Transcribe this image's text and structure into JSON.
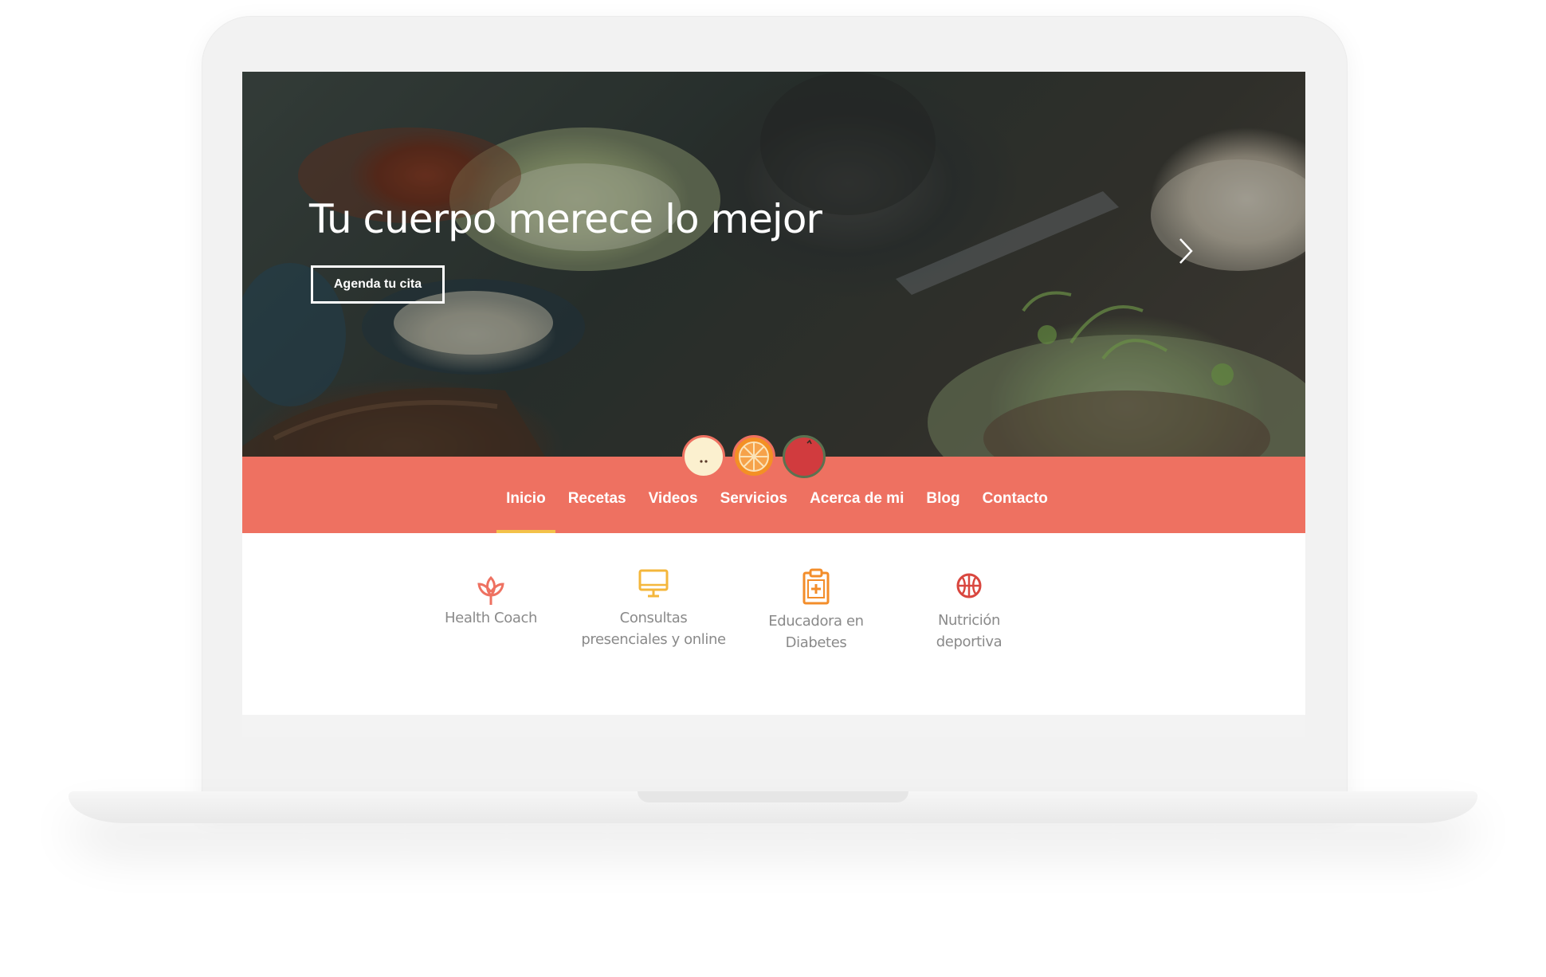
{
  "hero": {
    "title": "Tu cuerpo merece lo mejor",
    "cta_label": "Agenda tu cita",
    "next_icon": "chevron-right-icon"
  },
  "fruits": [
    {
      "name": "apple-icon",
      "color": "#fbf0cf"
    },
    {
      "name": "orange-icon",
      "color": "#f39025"
    },
    {
      "name": "pomegranate-icon",
      "color": "#d13b3e"
    }
  ],
  "nav": {
    "items": [
      {
        "label": "Inicio",
        "active": true
      },
      {
        "label": "Recetas",
        "active": false
      },
      {
        "label": "Videos",
        "active": false
      },
      {
        "label": "Servicios",
        "active": false
      },
      {
        "label": "Acerca de mi",
        "active": false
      },
      {
        "label": "Blog",
        "active": false
      },
      {
        "label": "Contacto",
        "active": false
      }
    ]
  },
  "services": [
    {
      "line1": "Health Coach",
      "line2": "",
      "icon": "lotus-icon",
      "color": "#ee7161"
    },
    {
      "line1": "Consultas",
      "line2": "presenciales y online",
      "icon": "monitor-icon",
      "color": "#f4b73c"
    },
    {
      "line1": "Educadora en",
      "line2": "Diabetes",
      "icon": "clipboard-medical-icon",
      "color": "#f38d2a"
    },
    {
      "line1": "Nutrición",
      "line2": "deportiva",
      "icon": "basketball-icon",
      "color": "#d9473f"
    }
  ],
  "colors": {
    "nav_background": "#ee7161",
    "active_underline": "#f3c24a",
    "service_text": "#8a8a8a"
  }
}
